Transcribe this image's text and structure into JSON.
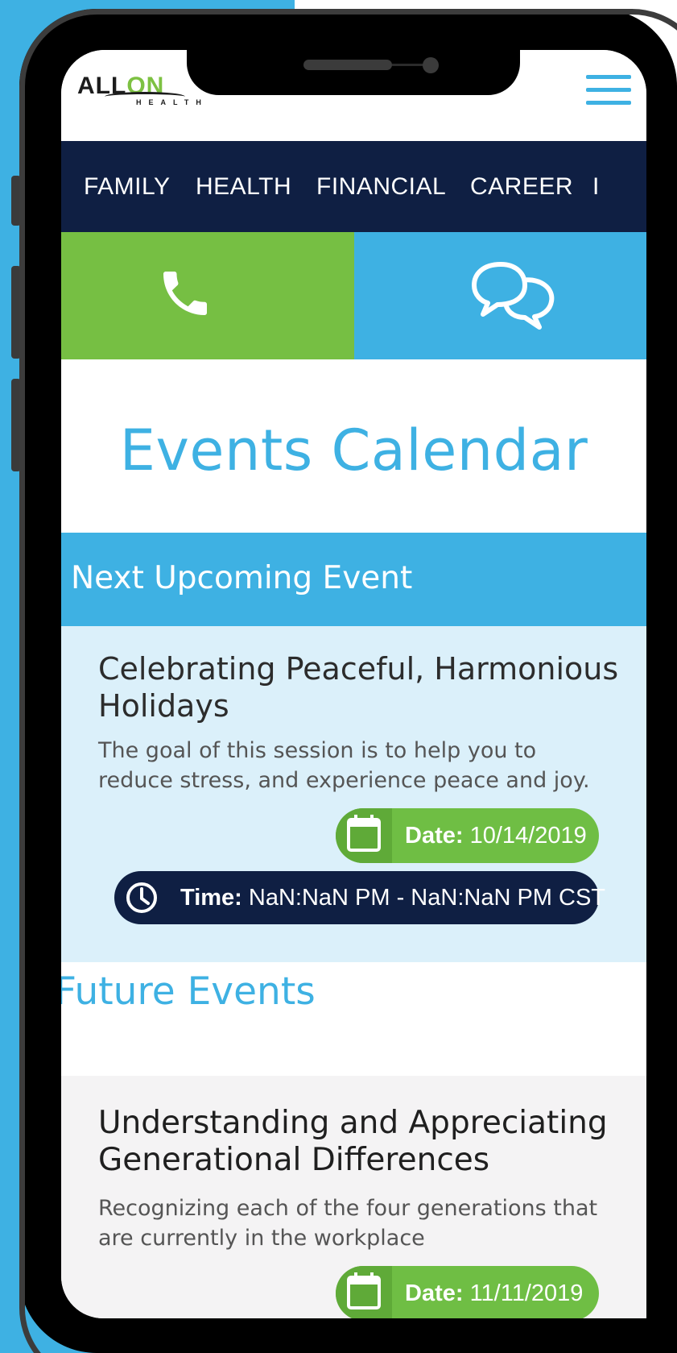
{
  "brand": {
    "logo_text_a": "ALL",
    "logo_text_b": "ON",
    "logo_sub": "HEALTH"
  },
  "nav": {
    "items": [
      "FAMILY",
      "HEALTH",
      "FINANCIAL",
      "CAREER",
      "I"
    ]
  },
  "contact": {
    "call_icon": "phone-icon",
    "chat_icon": "chat-bubbles-icon"
  },
  "page": {
    "title": "Events Calendar"
  },
  "next_event": {
    "section_label": "Next Upcoming Event",
    "title": "Celebrating Peaceful, Harmonious Holidays",
    "description": "The goal of this session is to help you to reduce stress, and experience peace and joy.",
    "date_label": "Date:",
    "date_value": "10/14/2019",
    "time_label": "Time:",
    "time_value": "NaN:NaN PM - NaN:NaN PM CST"
  },
  "future_events": {
    "section_label": "Future Events",
    "items": [
      {
        "title": "Understanding and Appreciating Generational Differences",
        "description": "Recognizing each of the four generations that are currently in the workplace",
        "date_label": "Date:",
        "date_value": "11/11/2019"
      }
    ]
  },
  "colors": {
    "blue": "#3eb1e3",
    "navy": "#0f1f43",
    "green": "#76bf43"
  }
}
